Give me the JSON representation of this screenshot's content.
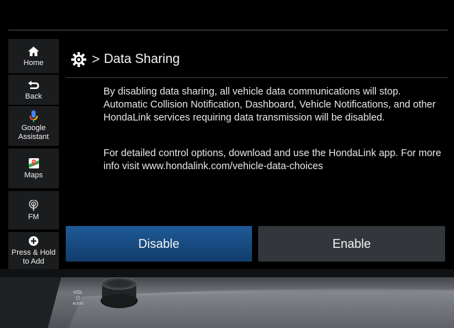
{
  "sidebar": {
    "items": [
      {
        "label": "Home",
        "icon": "home-icon"
      },
      {
        "label": "Back",
        "icon": "back-arrow-icon"
      },
      {
        "label": "Google Assistant",
        "icon": "google-assistant-icon"
      },
      {
        "label": "Maps",
        "icon": "maps-icon"
      },
      {
        "label": "FM",
        "icon": "radio-antenna-icon"
      },
      {
        "label": "Press & Hold to Add",
        "icon": "add-circle-icon"
      }
    ]
  },
  "header": {
    "icon": "gear-icon",
    "separator": ">",
    "title": "Data Sharing"
  },
  "message": {
    "paragraph1": "By disabling data sharing, all vehicle data communications will stop. Automatic Collision Notification, Dashboard, Vehicle Notifications, and other HondaLink services requiring data transmission will be disabled.",
    "paragraph2": "For detailed control options, download and use the HondaLink app. For more info visit www.hondalink.com/vehicle-data-choices"
  },
  "buttons": {
    "disable_label": "Disable",
    "enable_label": "Enable"
  },
  "bezel": {
    "vol_label": "VOL",
    "audio_label": "AUDIO"
  },
  "colors": {
    "disable_button": "#1a4f86",
    "enable_button": "#33363a",
    "sidebar_bg": "#1b1c1e"
  }
}
